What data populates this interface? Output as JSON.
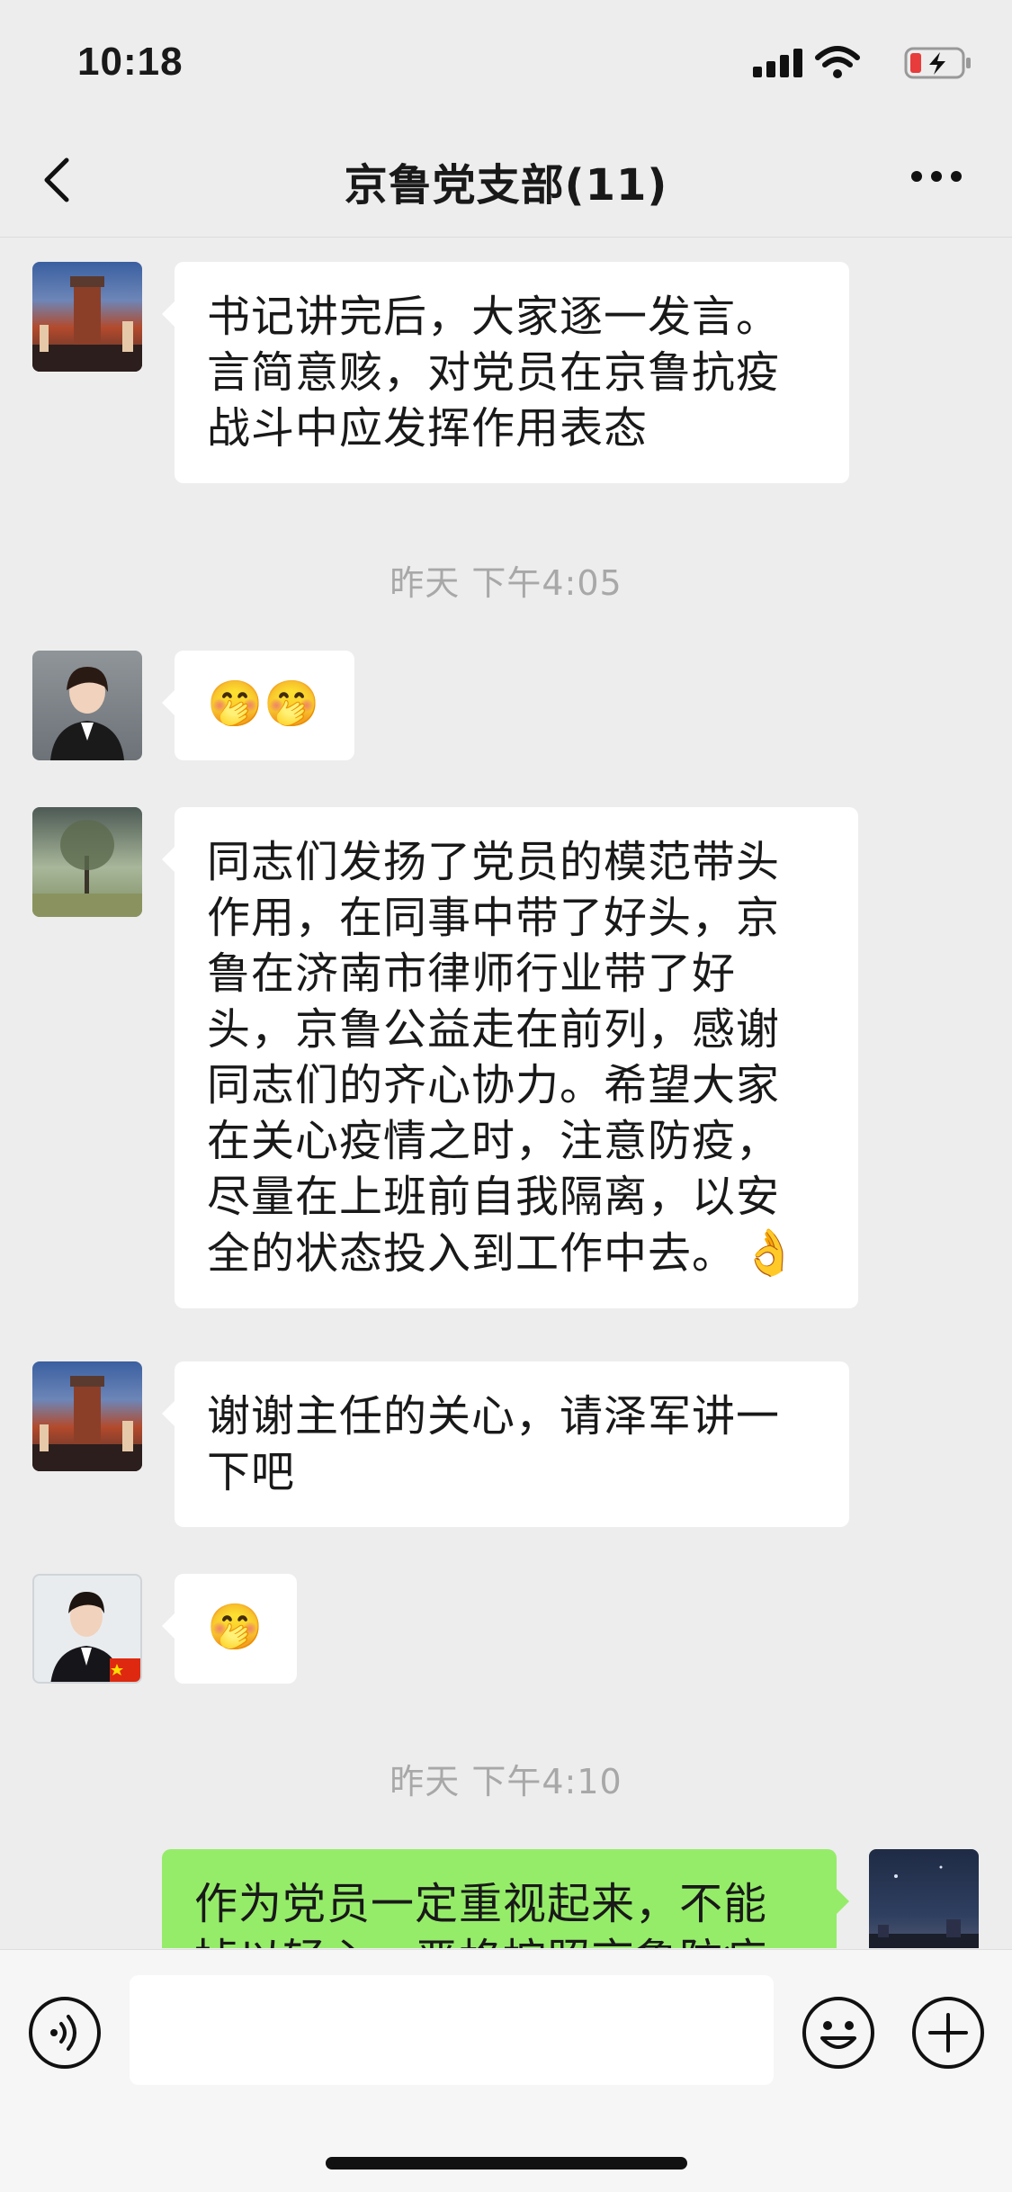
{
  "status_bar": {
    "time": "10:18"
  },
  "nav": {
    "title": "京鲁党支部(11)"
  },
  "messages": [
    {
      "lines": [
        "书记讲完后，大家逐一发言。",
        "言简意赅，对党员在京鲁抗疫",
        "战斗中应发挥作用表态"
      ]
    },
    {
      "timestamp": "昨天 下午4:05"
    },
    {
      "emojis": [
        "🤭",
        "🤭"
      ]
    },
    {
      "lines": [
        "同志们发扬了党员的模范带头",
        "作用，在同事中带了好头，京",
        "鲁在济南市律师行业带了好",
        "头，京鲁公益走在前列，感谢",
        "同志们的齐心协力。希望大家",
        "在关心疫情之时，注意防疫，",
        "尽量在上班前自我隔离，以安",
        "全的状态投入到工作中去。"
      ],
      "trailing_emoji": "👌"
    },
    {
      "lines": [
        "谢谢主任的关心，请泽军讲一",
        "下吧"
      ]
    },
    {
      "emojis": [
        "🤭"
      ]
    },
    {
      "timestamp": "昨天 下午4:10"
    },
    {
      "lines": [
        "作为党员一定重视起来，不能",
        "掉以轻心，严格按照京鲁防疫"
      ]
    }
  ],
  "colors": {
    "bubble_self": "#95EC69",
    "bubble_other": "#FFFFFF",
    "background": "#EDEDED"
  },
  "icons": [
    "signal-icon",
    "wifi-icon",
    "battery-icon",
    "back-icon",
    "more-icon",
    "voice-icon",
    "emoji-icon",
    "plus-icon"
  ]
}
